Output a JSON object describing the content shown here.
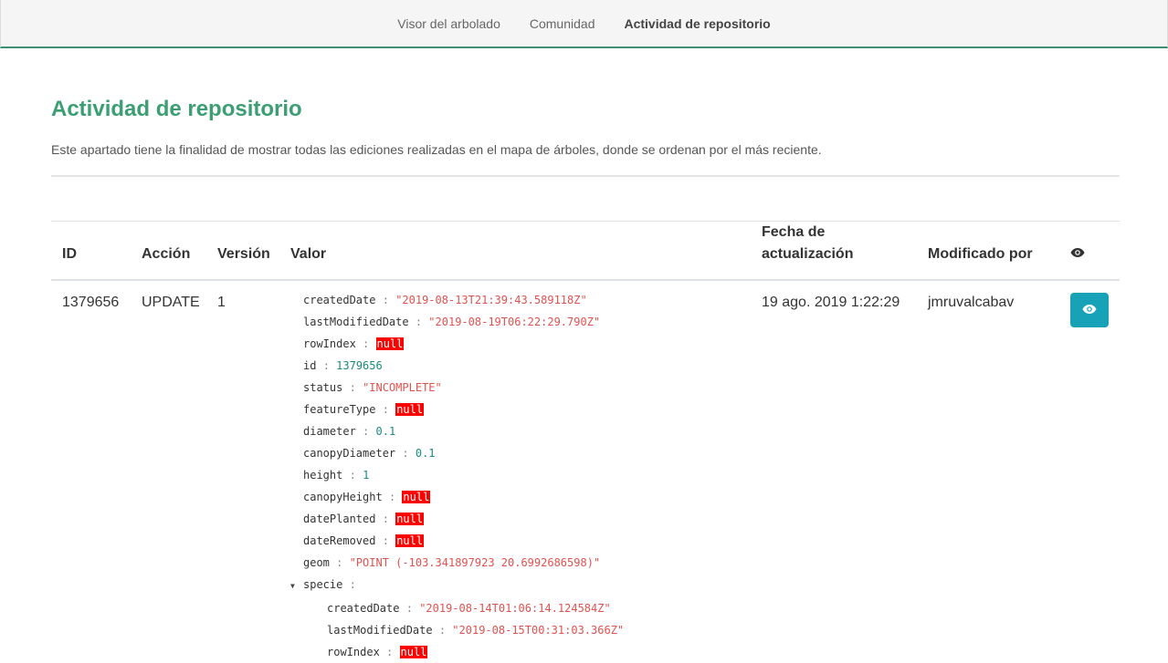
{
  "nav": {
    "items": [
      {
        "label": "Visor del arbolado",
        "active": false
      },
      {
        "label": "Comunidad",
        "active": false
      },
      {
        "label": "Actividad de repositorio",
        "active": true
      }
    ]
  },
  "page": {
    "title": "Actividad de repositorio",
    "description": "Este apartado tiene la finalidad de mostrar todas las ediciones realizadas en el mapa de árboles, donde se ordenan por el más reciente."
  },
  "table": {
    "headers": {
      "id": "ID",
      "action": "Acción",
      "version": "Versión",
      "value": "Valor",
      "date_line1": "Fecha de",
      "date_line2": "actualización",
      "modified_by": "Modificado por",
      "view_icon": "eye-icon"
    },
    "rows": [
      {
        "id": "1379656",
        "action": "UPDATE",
        "version": "1",
        "date": "19 ago. 2019 1:22:29",
        "modified_by": "jmruvalcabav",
        "value": {
          "createdDate": "\"2019-08-13T21:39:43.589118Z\"",
          "lastModifiedDate": "\"2019-08-19T06:22:29.790Z\"",
          "rowIndex": "null",
          "id": "1379656",
          "status": "\"INCOMPLETE\"",
          "featureType": "null",
          "diameter": "0.1",
          "canopyDiameter": "0.1",
          "height": "1",
          "canopyHeight": "null",
          "datePlanted": "null",
          "dateRemoved": "null",
          "geom": "\"POINT (-103.341897923 20.6992686598)\"",
          "specie_label": "specie",
          "specie": {
            "createdDate": "\"2019-08-14T01:06:14.124584Z\"",
            "lastModifiedDate": "\"2019-08-15T00:31:03.366Z\"",
            "rowIndex": "null"
          }
        }
      }
    ]
  },
  "colors": {
    "accent": "#3c9e73",
    "button": "#17a2b8",
    "null_bg": "#ff0000",
    "string": "#e0524f",
    "number": "#1a8a7a"
  }
}
